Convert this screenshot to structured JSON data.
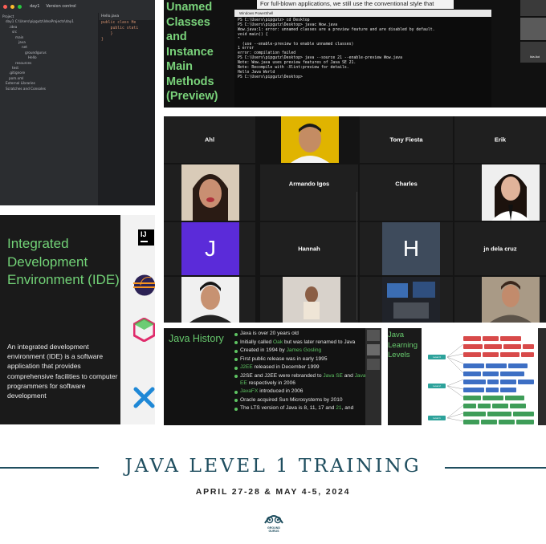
{
  "ide": {
    "title_bar": {
      "project": "day1",
      "vcs": "Version control"
    },
    "tab": "Hello.java",
    "tree": [
      "Project",
      "day1 C:\\Users\\pipgutz\\IdeaProjects\\day1",
      ".idea",
      "src",
      "main",
      "java",
      "net",
      "groundgurus",
      "Hello",
      "resources",
      "test",
      ".gitignore",
      "pom.xml",
      "External Libraries",
      "Scratches and Consoles"
    ],
    "code": [
      "public class He",
      "    public stati",
      "",
      "    }",
      "}"
    ]
  },
  "unnamed_slide": {
    "title": "Unamed Classes and Instance Main Methods (Preview)",
    "caption": "For full-blown applications, we still use the conventional style that",
    "powershell_title": "Windows PowerShell",
    "console_lines": [
      "PS C:\\Users\\pipgutz> cd Desktop",
      "PS C:\\Users\\pipgutz\\Desktop> javac Wow.java",
      "Wow.java:1: error: unnamed classes are a preview feature and are disabled by default.",
      "void main() {",
      "^",
      "  (use --enable-preview to enable unnamed classes)",
      "1 error",
      "error: compilation failed",
      "PS C:\\Users\\pipgutz\\Desktop> java --source 21 --enable-preview Wow.java",
      "Note: Wow.java uses preview features of Java SE 21.",
      "Note: Recompile with -Xlint:preview for details.",
      "Hello Java World",
      "PS C:\\Users\\pipgutz\\Desktop>"
    ],
    "cam_label": "Ida Aoi"
  },
  "zoom": {
    "participants": [
      "Ahl",
      "Tony Fiesta",
      "Erik",
      "Armando Igos",
      "Charles",
      "Hannah",
      "jn dela cruz"
    ],
    "avatars": [
      "J",
      "H"
    ]
  },
  "ide_slide": {
    "title": "Integrated Development Environment (IDE)",
    "description": "An integrated development environment (IDE) is a software application that provides comprehensive facilities to computer programmers for software development",
    "intellij_mark": "IJ"
  },
  "history": {
    "title": "Java History",
    "items": [
      [
        {
          "t": "Java is over 20 years old"
        }
      ],
      [
        {
          "t": "Initially called "
        },
        {
          "t": "Oak",
          "hl": true
        },
        {
          "t": " but was later renamed to Java"
        }
      ],
      [
        {
          "t": "Created in 1994 by "
        },
        {
          "t": "James Gosling",
          "hl": true
        }
      ],
      [
        {
          "t": "First public release was in early 1995"
        }
      ],
      [
        {
          "t": "J2EE",
          "hl": true
        },
        {
          "t": " released in December 1999"
        }
      ],
      [
        {
          "t": "J2SE and J2EE were rebranded to "
        },
        {
          "t": "Java SE",
          "hl": true
        },
        {
          "t": " and "
        },
        {
          "t": "Java EE",
          "hl": true
        },
        {
          "t": " respectively in 2006"
        }
      ],
      [
        {
          "t": "JavaFX",
          "hl": true
        },
        {
          "t": " introduced in 2006"
        }
      ],
      [
        {
          "t": "Oracle acquired Sun Microsystems by 2010"
        }
      ],
      [
        {
          "t": "The LTS version of Java is 8, 11, 17 and "
        },
        {
          "t": "21",
          "hl": true
        },
        {
          "t": ", and"
        }
      ]
    ]
  },
  "levels": {
    "title": "Java Learning Levels",
    "nodes": [
      "Level 3",
      "Level 2",
      "Level 1"
    ]
  },
  "footer": {
    "heading": "JAVA LEVEL 1 TRAINING",
    "dates": "APRIL 27-28 & MAY 4-5, 2024",
    "brand": [
      "GROUND",
      "GURUS"
    ]
  },
  "colors": {
    "accent_green": "#72d277",
    "footer_teal": "#1f4e5f",
    "avatar_purple": "#5b2bd9",
    "avatar_slate": "#3e4b5c"
  },
  "icons": [
    "intellij-logo-icon",
    "eclipse-logo-icon",
    "netbeans-logo-icon",
    "vscode-logo-icon",
    "groundgurus-logo-icon"
  ]
}
